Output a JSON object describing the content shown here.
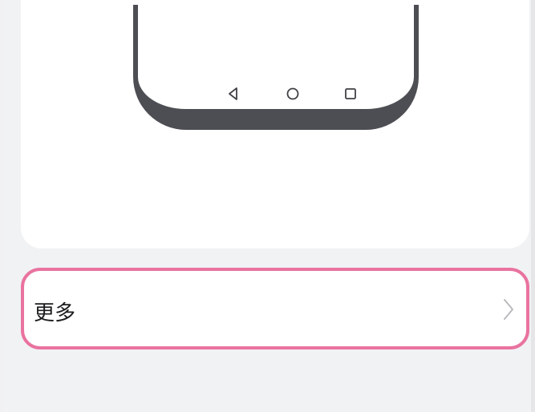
{
  "preview": {
    "nav_bar_icons": [
      "back-triangle-icon",
      "home-circle-icon",
      "recent-square-icon"
    ]
  },
  "more_row": {
    "label": "更多",
    "chevron_icon": "chevron-right-icon"
  },
  "colors": {
    "background": "#f1f2f4",
    "card": "#ffffff",
    "phone_frame": "#4d4e53",
    "highlight_border": "#e9739f",
    "chevron": "#b6b6ba"
  }
}
